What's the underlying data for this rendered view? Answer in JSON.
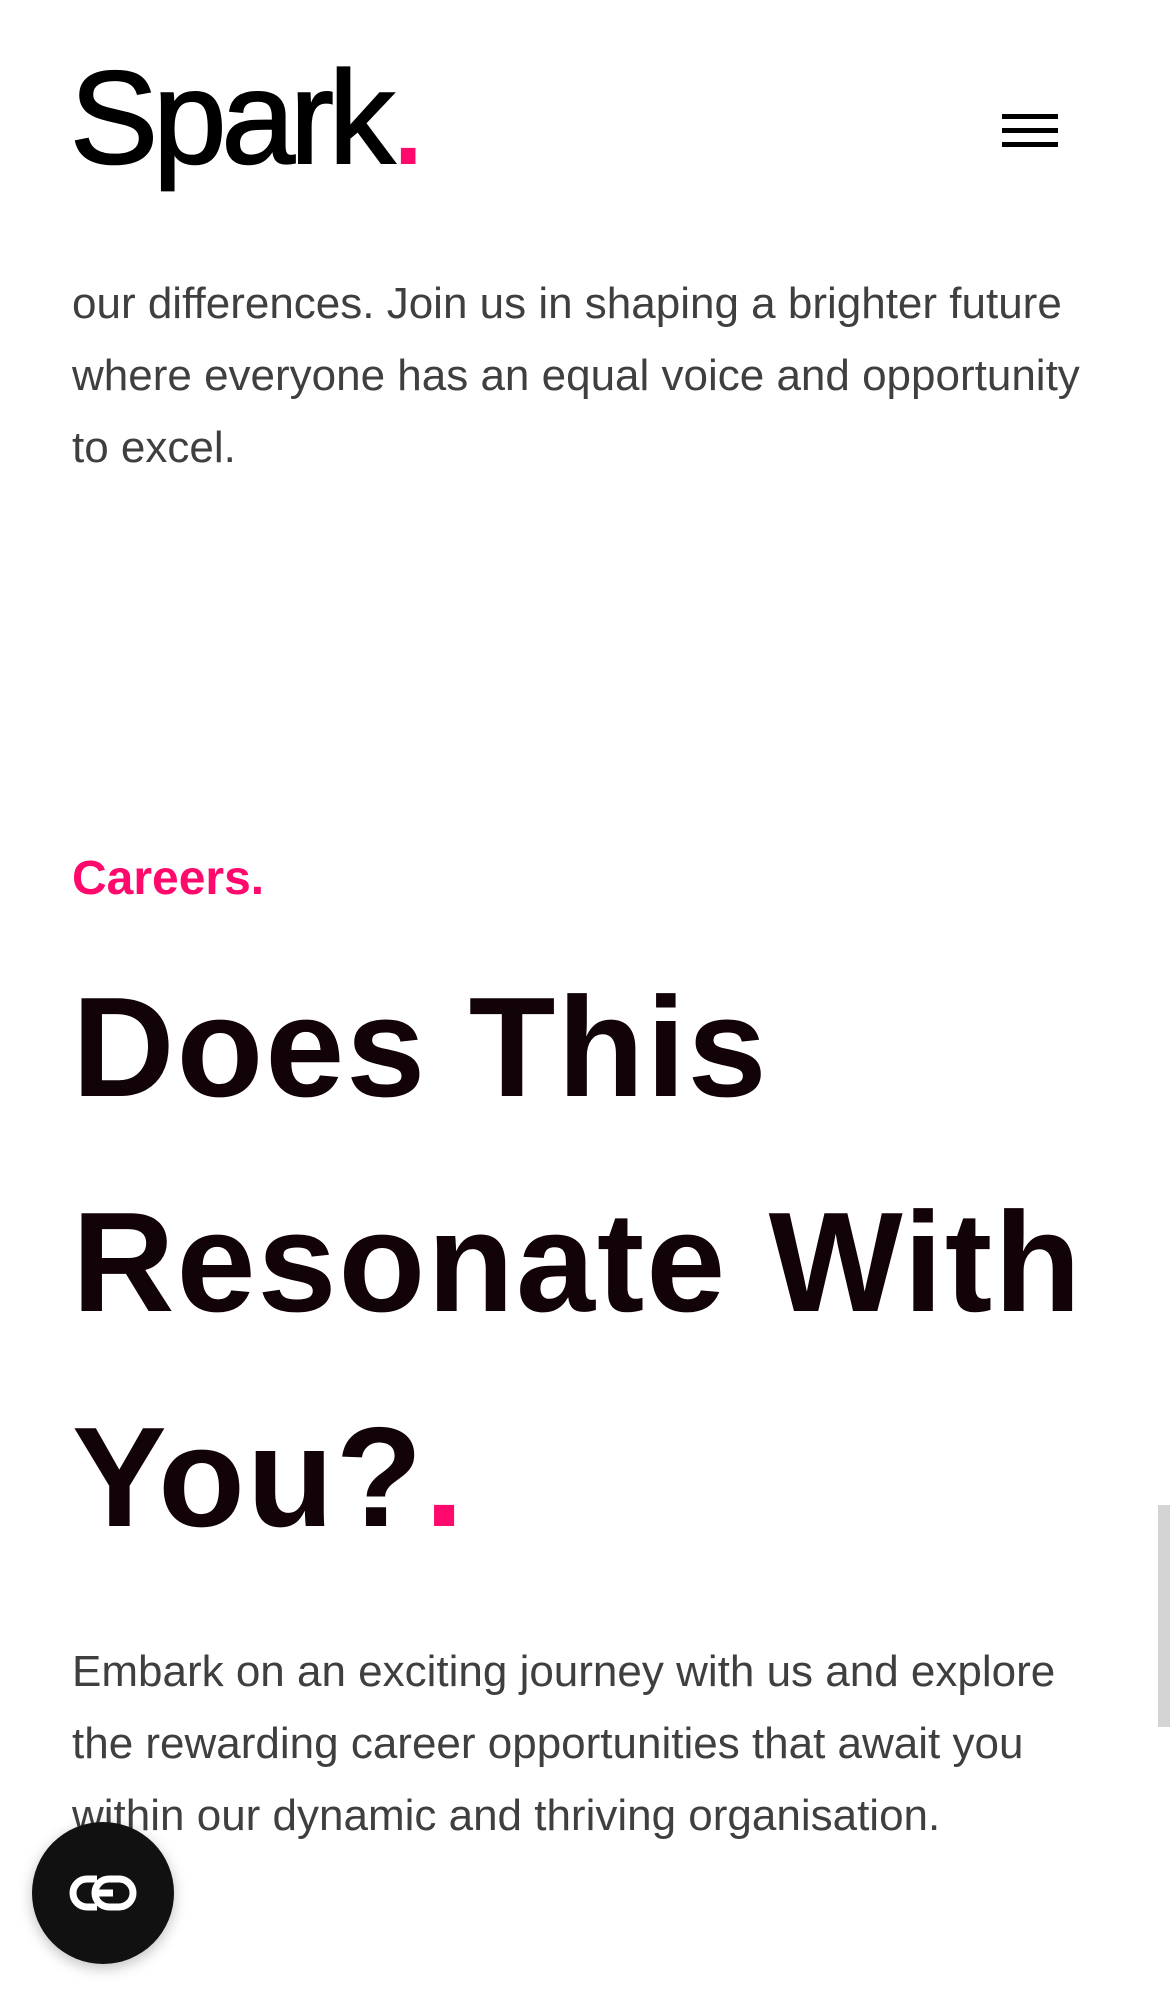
{
  "header": {
    "logo_text": "Spark",
    "logo_dot": "."
  },
  "intro": {
    "text": "our differences. Join us in shaping a brighter future where everyone has an equal voice and opportunity to excel."
  },
  "careers": {
    "eyebrow": "Careers.",
    "headline_line1": "Does This",
    "headline_line2": "Resonate With",
    "headline_line3": "You?",
    "headline_dot": ".",
    "body": "Embark on an exciting journey with us and explore the rewarding career opportunities that await you within our dynamic and thriving organisation."
  },
  "colors": {
    "accent": "#ff0a6c",
    "heading": "#120308",
    "body": "#3f3f3f"
  },
  "icons": {
    "menu": "hamburger-menu-icon",
    "cookie": "cookie-consent-icon"
  }
}
